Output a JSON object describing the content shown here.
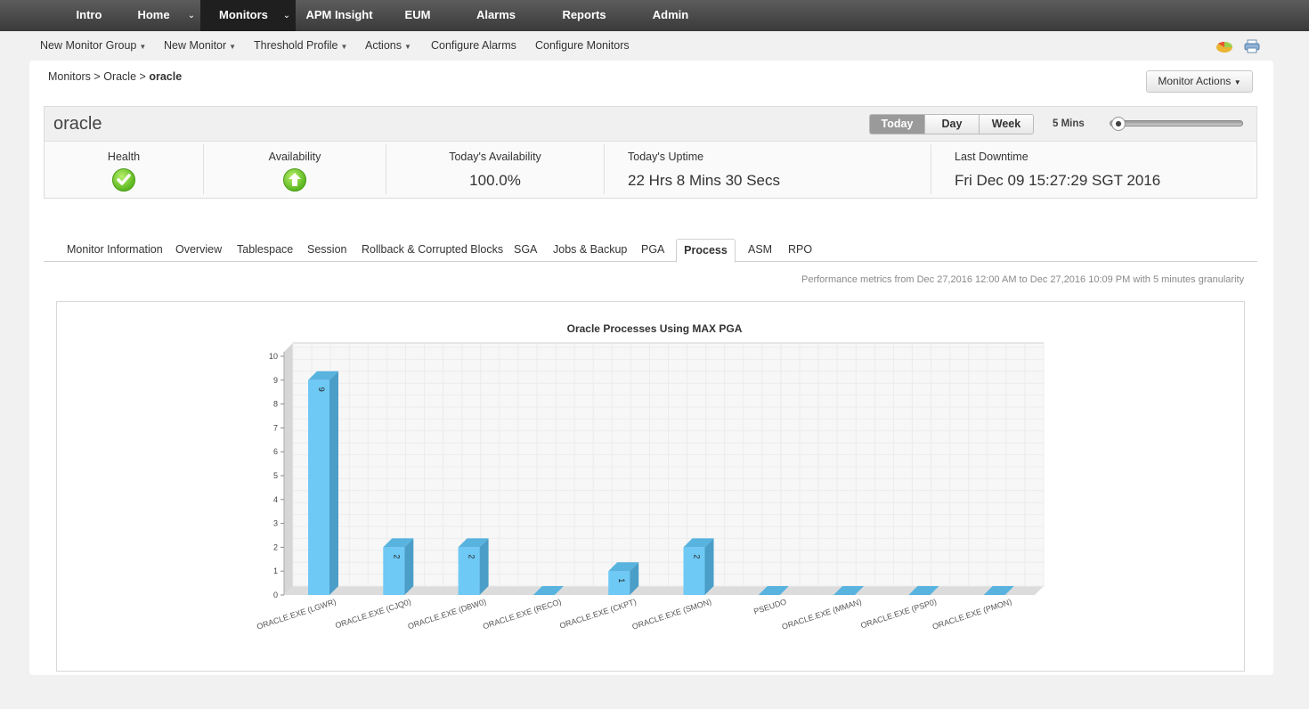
{
  "topnav": {
    "items": [
      {
        "label": "Intro"
      },
      {
        "label": "Home"
      },
      {
        "label": "Monitors"
      },
      {
        "label": "APM Insight"
      },
      {
        "label": "EUM"
      },
      {
        "label": "Alarms"
      },
      {
        "label": "Reports"
      },
      {
        "label": "Admin"
      }
    ],
    "active": "Monitors"
  },
  "submenu": {
    "items": [
      {
        "label": "New Monitor Group"
      },
      {
        "label": "New Monitor"
      },
      {
        "label": "Threshold Profile"
      },
      {
        "label": "Actions"
      },
      {
        "label": "Configure Alarms"
      },
      {
        "label": "Configure Monitors"
      }
    ]
  },
  "breadcrumb": {
    "part1": "Monitors",
    "sep": ">",
    "part2": "Oracle",
    "current": "oracle"
  },
  "monitor_actions_label": "Monitor Actions",
  "summary": {
    "name": "oracle",
    "ranges": [
      {
        "label": "Today"
      },
      {
        "label": "Day"
      },
      {
        "label": "Week"
      }
    ],
    "active_range": "Today",
    "granularity": "5 Mins",
    "health": {
      "label": "Health",
      "status": "ok"
    },
    "availability": {
      "label": "Availability",
      "status": "up"
    },
    "todays_availability": {
      "label": "Today's Availability",
      "value": "100.0%"
    },
    "todays_uptime": {
      "label": "Today's Uptime",
      "value": "22 Hrs 8 Mins 30 Secs"
    },
    "last_downtime": {
      "label": "Last Downtime",
      "value": "Fri Dec 09 15:27:29 SGT 2016"
    }
  },
  "tabs": [
    {
      "label": "Monitor Information"
    },
    {
      "label": "Overview"
    },
    {
      "label": "Tablespace"
    },
    {
      "label": "Session"
    },
    {
      "label": "Rollback & Corrupted Blocks"
    },
    {
      "label": "SGA"
    },
    {
      "label": "Jobs & Backup"
    },
    {
      "label": "PGA"
    },
    {
      "label": "Process"
    },
    {
      "label": "ASM"
    },
    {
      "label": "RPO"
    }
  ],
  "active_tab": "Process",
  "perf_note": "Performance metrics from Dec 27,2016 12:00 AM to Dec 27,2016 10:09 PM with 5 minutes granularity",
  "colors": {
    "bar_front": "#6ec9f5",
    "bar_side": "#4a9ec8",
    "bar_top": "#58b3df",
    "nav_active": "#1f1f1f"
  },
  "chart_data": {
    "type": "bar",
    "title": "Oracle Processes Using MAX PGA",
    "categories": [
      "ORACLE.EXE (LGWR)",
      "ORACLE.EXE (CJQ0)",
      "ORACLE.EXE (DBW0)",
      "ORACLE.EXE (RECO)",
      "ORACLE.EXE (CKPT)",
      "ORACLE.EXE (SMON)",
      "PSEUDO",
      "ORACLE.EXE (MMAN)",
      "ORACLE.EXE (PSP0)",
      "ORACLE.EXE (PMON)"
    ],
    "values": [
      9,
      2,
      2,
      0,
      1,
      2,
      0,
      0,
      0,
      0
    ],
    "ylim": [
      0,
      10
    ],
    "yticks": [
      "0",
      "1",
      "2",
      "3",
      "4",
      "5",
      "6",
      "7",
      "8",
      "9",
      "10"
    ],
    "grid": true,
    "style": "3d"
  }
}
